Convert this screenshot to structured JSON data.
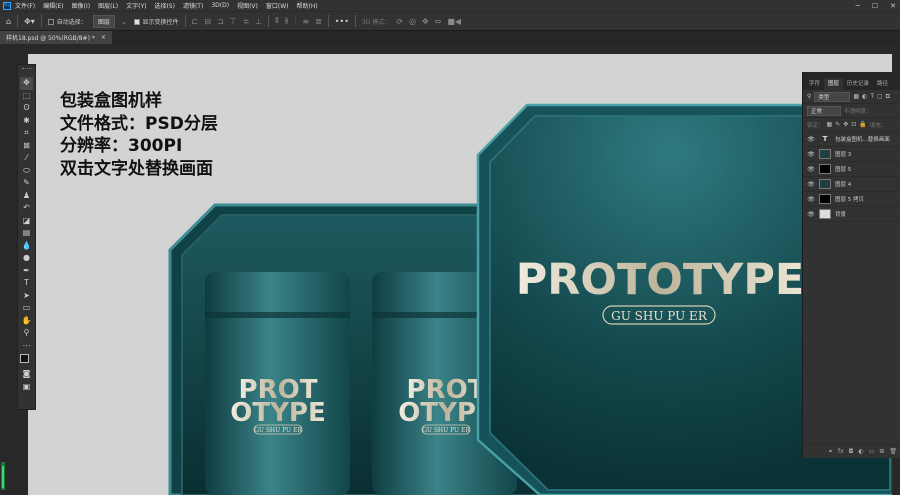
{
  "menubar": {
    "app_icon": "Ps",
    "items": [
      "文件(F)",
      "编辑(E)",
      "图像(I)",
      "图层(L)",
      "文字(Y)",
      "选择(S)",
      "滤镜(T)",
      "3D(D)",
      "视图(V)",
      "窗口(W)",
      "帮助(H)"
    ]
  },
  "optionsbar": {
    "auto_select_label": "自动选择：",
    "auto_select_target": "图层",
    "show_transform_label": "显示变换控件",
    "mode3d_label": "3D 模式："
  },
  "document_tab": {
    "title": "样机18.psd @ 50%(RGB/8#) *",
    "close_glyph": "×"
  },
  "overlay": {
    "line1": "包装盒图机样",
    "line2": "文件格式：PSD分层",
    "line3": "分辨率：300PI",
    "line4": "双击文字处替换画面"
  },
  "artwork": {
    "lid_title": "PROTOTYPE",
    "lid_subtitle": "GU SHU PU ER",
    "can1_line1": "PROT",
    "can1_line2": "OTYPE",
    "can1_sub": "GU SHU PU ER",
    "can2_line1": "PROT",
    "can2_line2": "OTYPE",
    "can2_sub": "GU SHU PU ER",
    "colors": {
      "teal_dark": "#0d3a3e",
      "teal_mid": "#1f5e63",
      "teal_light": "#3b8c91",
      "gold": "#d8cdb4",
      "canvas_bg": "#d2d3d3"
    }
  },
  "panels": {
    "tabs": [
      "字符",
      "图层",
      "历史记录",
      "路径"
    ],
    "active_tab_index": 1,
    "filter_label": "类型",
    "blend_mode": "正常",
    "opacity_label": "不透明度：",
    "lock_label": "锁定：",
    "fill_label": "填充：",
    "layers": [
      {
        "kind": "text",
        "name": "包装盒图机...替换画面"
      },
      {
        "kind": "smart",
        "name": "图层 3"
      },
      {
        "kind": "mask",
        "name": "图层 5"
      },
      {
        "kind": "smart",
        "name": "图层 4"
      },
      {
        "kind": "mask",
        "name": "图层 5 拷贝"
      },
      {
        "kind": "white",
        "name": "背景"
      }
    ]
  },
  "toolbar": {
    "tools": [
      {
        "name": "move-tool-icon",
        "glyph": "✥"
      },
      {
        "name": "marquee-tool-icon",
        "glyph": "⬚"
      },
      {
        "name": "lasso-tool-icon",
        "glyph": "ʘ"
      },
      {
        "name": "magic-wand-icon",
        "glyph": "✱"
      },
      {
        "name": "crop-tool-icon",
        "glyph": "⌗"
      },
      {
        "name": "frame-tool-icon",
        "glyph": "⊠"
      },
      {
        "name": "eyedropper-icon",
        "glyph": "⁄"
      },
      {
        "name": "healing-brush-icon",
        "glyph": "⬭"
      },
      {
        "name": "brush-tool-icon",
        "glyph": "✎"
      },
      {
        "name": "stamp-tool-icon",
        "glyph": "♟"
      },
      {
        "name": "history-brush-icon",
        "glyph": "↶"
      },
      {
        "name": "eraser-tool-icon",
        "glyph": "◪"
      },
      {
        "name": "gradient-tool-icon",
        "glyph": "▤"
      },
      {
        "name": "blur-tool-icon",
        "glyph": "💧"
      },
      {
        "name": "dodge-tool-icon",
        "glyph": "●"
      },
      {
        "name": "pen-tool-icon",
        "glyph": "✒"
      },
      {
        "name": "type-tool-icon",
        "glyph": "T"
      },
      {
        "name": "path-select-icon",
        "glyph": "➤"
      },
      {
        "name": "shape-tool-icon",
        "glyph": "▭"
      },
      {
        "name": "hand-tool-icon",
        "glyph": "✋"
      },
      {
        "name": "zoom-tool-icon",
        "glyph": "⚲"
      },
      {
        "name": "more-tools-icon",
        "glyph": "⋯"
      }
    ]
  }
}
